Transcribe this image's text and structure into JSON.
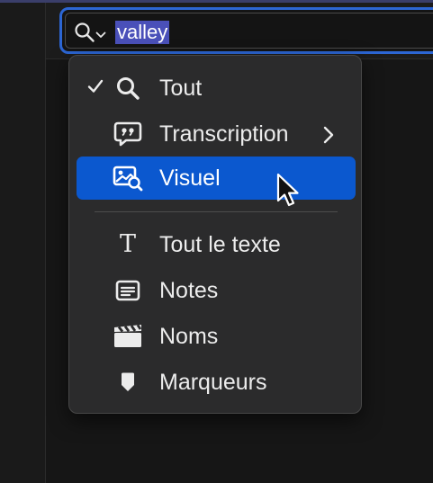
{
  "search": {
    "value": "valley",
    "icon": "magnifier-icon",
    "accent": "#2c66d4",
    "selection_highlight": "#4a50b9"
  },
  "menu": {
    "items": [
      {
        "label": "Tout",
        "icon": "magnifier-icon",
        "checked": true
      },
      {
        "label": "Transcription",
        "icon": "quote-bubble-icon",
        "has_submenu": true
      },
      {
        "label": "Visuel",
        "icon": "image-search-icon",
        "highlighted": true
      },
      {
        "label": "Tout le texte",
        "icon": "text-t-icon",
        "glyph": "T"
      },
      {
        "label": "Notes",
        "icon": "notes-icon"
      },
      {
        "label": "Noms",
        "icon": "clapper-icon"
      },
      {
        "label": "Marqueurs",
        "icon": "marker-icon"
      }
    ],
    "selection_color": "#0b58cf"
  }
}
